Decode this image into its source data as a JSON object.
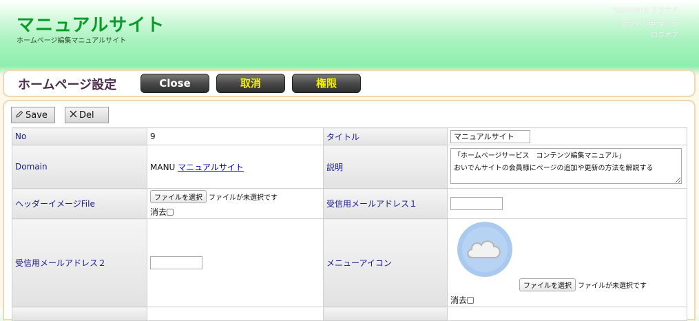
{
  "header": {
    "site_title": "マニュアルサイト",
    "site_subtitle": "ホームページ編集マニュアルサイト",
    "brand": "TAKAMINE クラウド",
    "login_status": "ログイン中 タック",
    "logout": "ログオフ"
  },
  "titlebar": {
    "page_title": "ホームページ設定",
    "close_label": "Close",
    "cancel_label": "取消",
    "permission_label": "権限"
  },
  "toolbar": {
    "save_label": "Save",
    "del_label": "Del"
  },
  "form": {
    "no_label": "No",
    "no_value": "9",
    "title_label": "タイトル",
    "title_value": "マニュアルサイト",
    "domain_label": "Domain",
    "domain_code": "MANU",
    "domain_link": "マニュアルサイト",
    "description_label": "説明",
    "description_value": "「ホームページサービス　コンテンツ編集マニュアル」\nおいでんサイトの会員様にページの追加や更新の方法を解説する",
    "header_image_label": "ヘッダーイメージFile",
    "file_button_label": "ファイルを選択",
    "file_status": "ファイルが未選択です",
    "delete_label": "消去",
    "mail1_label": "受信用メールアドレス１",
    "mail1_value": "",
    "mail2_label": "受信用メールアドレス２",
    "mail2_value": "",
    "menu_icon_label": "メニューアイコン"
  },
  "colors": {
    "site_title": "#0c9a2a",
    "label_text": "#1a1a8c",
    "nav_button_dark": "#3a3a3a",
    "nav_button_yellow_text": "#f3f300"
  },
  "icons": {
    "save": "pencil-icon",
    "del": "x-icon",
    "menu_icon": "cloud-icon"
  }
}
